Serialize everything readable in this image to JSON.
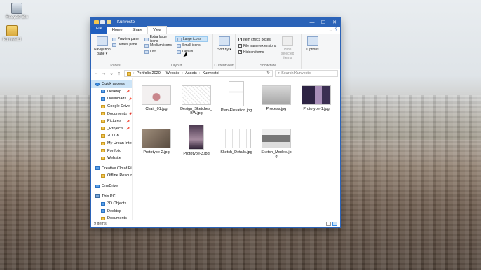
{
  "desktop": {
    "icons": [
      {
        "label": "Recycle Bin",
        "icon": "recycle-bin-icon"
      },
      {
        "label": "Kunvestol",
        "icon": "folder-icon"
      }
    ]
  },
  "window": {
    "title": "Kunvestol",
    "controls": {
      "minimize": "—",
      "maximize": "☐",
      "close": "✕"
    }
  },
  "ribbon_tabs": [
    "File",
    "Home",
    "Share",
    "View"
  ],
  "ribbon_tabs_active": "View",
  "ribbon": {
    "panes": {
      "label": "Panes",
      "nav_pane": "Navigation pane ▾",
      "preview_pane": "Preview pane",
      "details_pane": "Details pane"
    },
    "layout": {
      "label": "Layout",
      "options": [
        "Extra large icons",
        "Large icons",
        "Medium icons",
        "Small icons",
        "List",
        "Details"
      ],
      "selected": "Large icons"
    },
    "current_view": {
      "label": "Current view",
      "sort_by": "Sort by ▾"
    },
    "show_hide": {
      "label": "Show/hide",
      "item_checkboxes": "Item check boxes",
      "file_name_extensions": "File name extensions",
      "hidden_items": "Hidden items",
      "hide_selected": "Hide selected items",
      "checks": {
        "item_checkboxes": true,
        "file_name_extensions": true,
        "hidden_items": true
      }
    },
    "options": {
      "label": "Options"
    }
  },
  "address": {
    "back": "←",
    "forward": "→",
    "recent": "⌄",
    "up": "↑",
    "crumbs": [
      "Portfolio 2020",
      "Website",
      "Assets",
      "Kunvestol"
    ],
    "refresh": "↻",
    "search_placeholder": "Search Kunvestol"
  },
  "nav": [
    {
      "label": "Quick access",
      "type": "star",
      "indent": false,
      "pin": false,
      "selected": true
    },
    {
      "label": "Desktop",
      "type": "blue",
      "indent": true,
      "pin": true
    },
    {
      "label": "Downloads",
      "type": "blue",
      "indent": true,
      "pin": true
    },
    {
      "label": "Google Drive",
      "type": "folder",
      "indent": true,
      "pin": true
    },
    {
      "label": "Documents",
      "type": "folder",
      "indent": true,
      "pin": true
    },
    {
      "label": "Pictures",
      "type": "folder",
      "indent": true,
      "pin": true
    },
    {
      "label": "_Projects",
      "type": "folder",
      "indent": true,
      "pin": true
    },
    {
      "label": "2011-b",
      "type": "folder",
      "indent": true,
      "pin": false
    },
    {
      "label": "My Urban Interio",
      "type": "folder",
      "indent": true,
      "pin": false
    },
    {
      "label": "Portfolio",
      "type": "folder",
      "indent": true,
      "pin": false
    },
    {
      "label": "Website",
      "type": "folder",
      "indent": true,
      "pin": false
    },
    {
      "label": "Creative Cloud Fil",
      "type": "blue",
      "indent": false,
      "pin": false
    },
    {
      "label": "Offline Resource",
      "type": "folder",
      "indent": true,
      "pin": false
    },
    {
      "label": "OneDrive",
      "type": "blue",
      "indent": false,
      "pin": false
    },
    {
      "label": "This PC",
      "type": "pc",
      "indent": false,
      "pin": false
    },
    {
      "label": "3D Objects",
      "type": "blue",
      "indent": true,
      "pin": false
    },
    {
      "label": "Desktop",
      "type": "blue",
      "indent": true,
      "pin": false
    },
    {
      "label": "Documents",
      "type": "folder",
      "indent": true,
      "pin": false
    }
  ],
  "files": [
    {
      "name": "Chair_01.jpg",
      "thumb": "chair"
    },
    {
      "name": "Design_Sketches_BW.jpg",
      "thumb": "sketch"
    },
    {
      "name": "Plan-Elevation.jpg",
      "thumb": "plan",
      "tall": true
    },
    {
      "name": "Process.jpg",
      "thumb": "process"
    },
    {
      "name": "Prototype-1.jpg",
      "thumb": "proto1"
    },
    {
      "name": "Prototype-2.jpg",
      "thumb": "proto2"
    },
    {
      "name": "Prototype-3.jpg",
      "thumb": "proto3",
      "tall": true
    },
    {
      "name": "Sketch_Details.jpg",
      "thumb": "details"
    },
    {
      "name": "Sketch_Models.jpg",
      "thumb": "models"
    }
  ],
  "status": {
    "count": "9 items"
  },
  "colors": {
    "title_bar": "#2b63b8",
    "selection": "#cce4f7",
    "accent": "#1f5fbf"
  }
}
